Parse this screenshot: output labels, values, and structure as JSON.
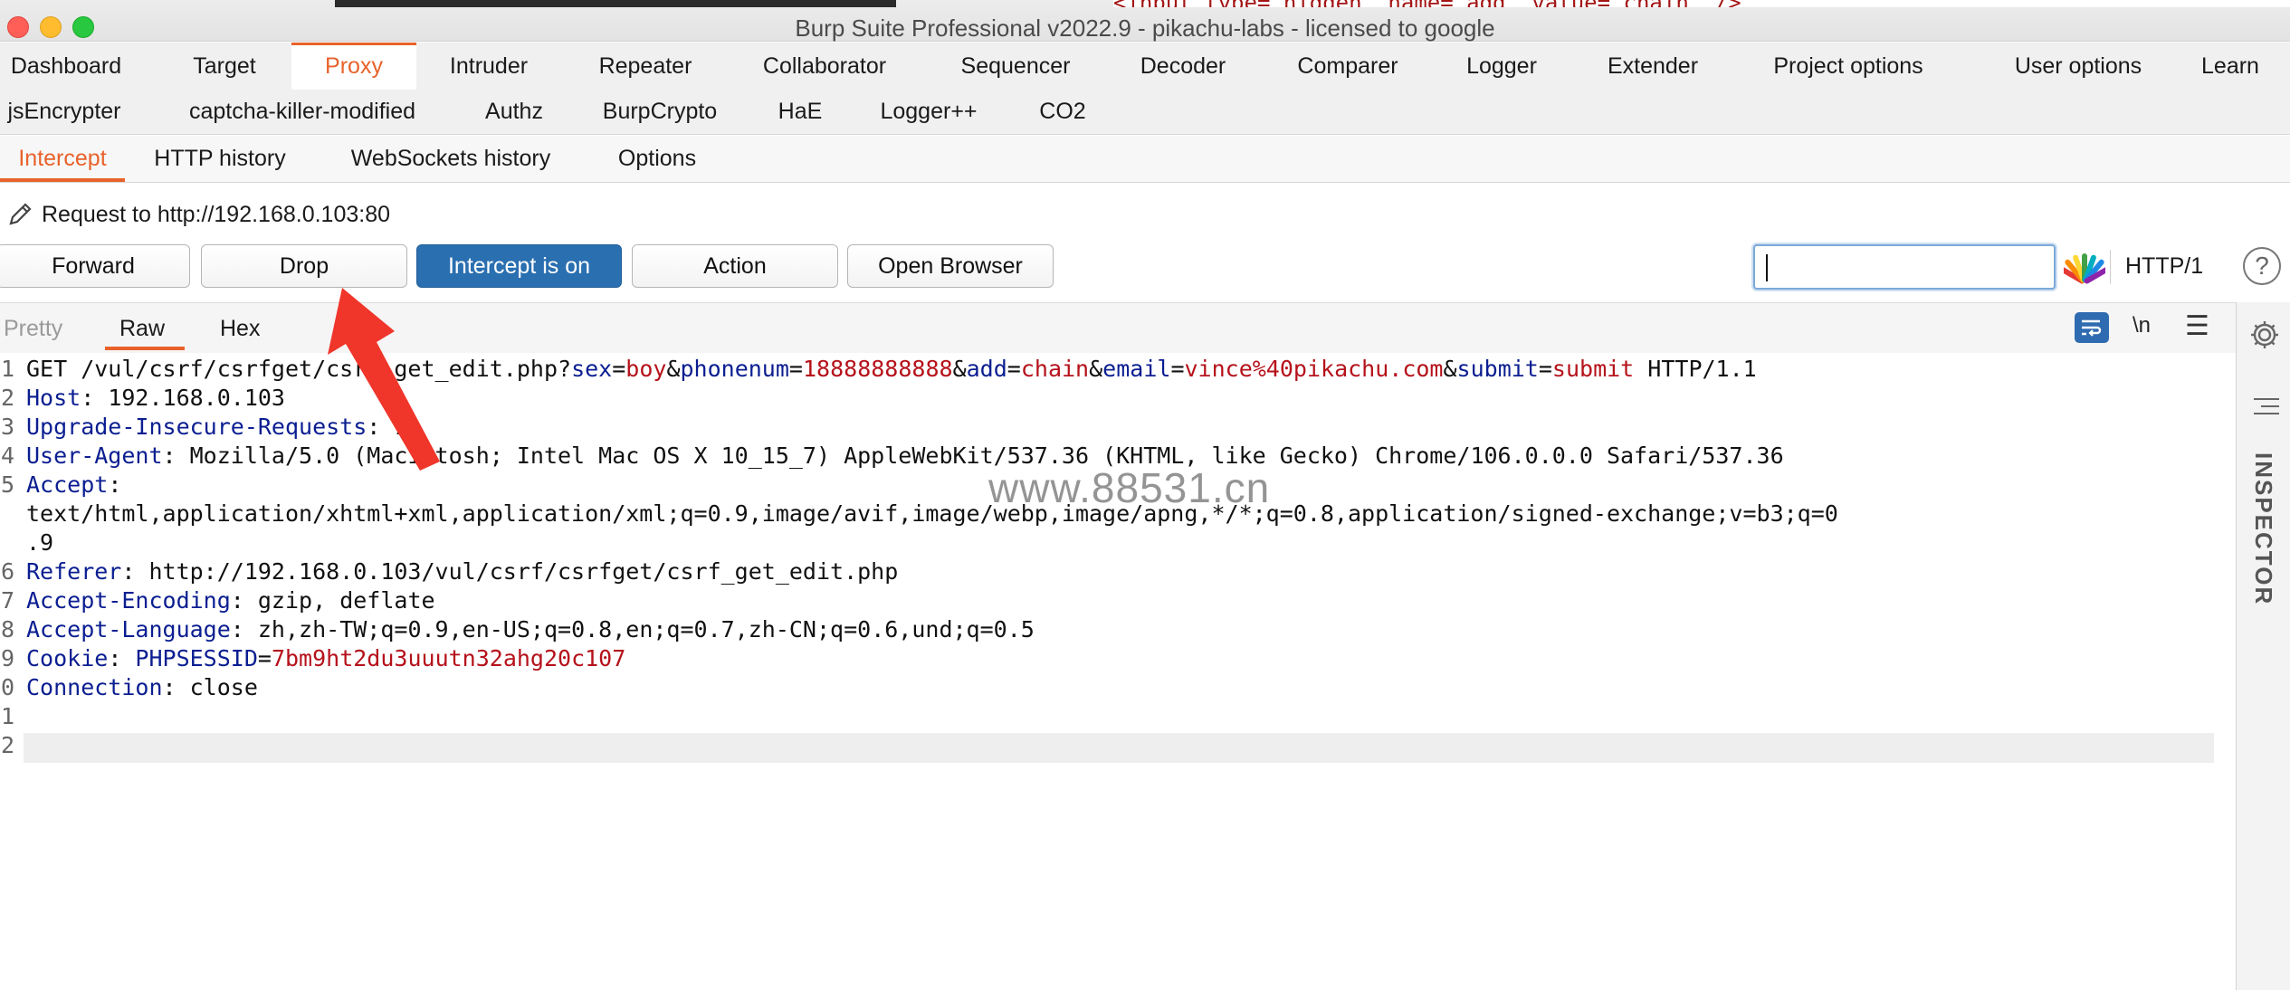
{
  "window": {
    "title": "Burp Suite Professional v2022.9 - pikachu-labs - licensed to google",
    "background_snippet": "<input type=\"hidden\" name=\"add\" value=\"chain\" />"
  },
  "main_tabs": [
    {
      "label": "Dashboard"
    },
    {
      "label": "Target"
    },
    {
      "label": "Proxy",
      "active": true
    },
    {
      "label": "Intruder"
    },
    {
      "label": "Repeater"
    },
    {
      "label": "Collaborator"
    },
    {
      "label": "Sequencer"
    },
    {
      "label": "Decoder"
    },
    {
      "label": "Comparer"
    },
    {
      "label": "Logger"
    },
    {
      "label": "Extender"
    },
    {
      "label": "Project options"
    },
    {
      "label": "User options"
    },
    {
      "label": "Learn"
    }
  ],
  "extension_tabs": [
    {
      "label": "jsEncrypter"
    },
    {
      "label": "captcha-killer-modified"
    },
    {
      "label": "Authz"
    },
    {
      "label": "BurpCrypto"
    },
    {
      "label": "HaE"
    },
    {
      "label": "Logger++"
    },
    {
      "label": "CO2"
    }
  ],
  "proxy_tabs": [
    {
      "label": "Intercept",
      "active": true
    },
    {
      "label": "HTTP history"
    },
    {
      "label": "WebSockets history"
    },
    {
      "label": "Options"
    }
  ],
  "request_info": "Request to http://192.168.0.103:80",
  "toolbar": {
    "forward": "Forward",
    "drop": "Drop",
    "intercept": "Intercept is on",
    "action": "Action",
    "open_browser": "Open Browser",
    "search_value": "",
    "http_version": "HTTP/1",
    "help": "?"
  },
  "editor": {
    "tabs": {
      "pretty": "Pretty",
      "raw": "Raw",
      "hex": "Hex"
    },
    "newline_toggle": "\\n",
    "lines": [
      {
        "n": "1",
        "parts": [
          {
            "t": "GET /vul/csrf/csrfget/csrf_get_edit.php?",
            "c": ""
          },
          {
            "t": "sex",
            "c": "pk"
          },
          {
            "t": "=",
            "c": ""
          },
          {
            "t": "boy",
            "c": "pv"
          },
          {
            "t": "&",
            "c": ""
          },
          {
            "t": "phonenum",
            "c": "pk"
          },
          {
            "t": "=",
            "c": ""
          },
          {
            "t": "18888888888",
            "c": "pv"
          },
          {
            "t": "&",
            "c": ""
          },
          {
            "t": "add",
            "c": "pk"
          },
          {
            "t": "=",
            "c": ""
          },
          {
            "t": "chain",
            "c": "pv"
          },
          {
            "t": "&",
            "c": ""
          },
          {
            "t": "email",
            "c": "pk"
          },
          {
            "t": "=",
            "c": ""
          },
          {
            "t": "vince%40pikachu.com",
            "c": "pv"
          },
          {
            "t": "&",
            "c": ""
          },
          {
            "t": "submit",
            "c": "pk"
          },
          {
            "t": "=",
            "c": ""
          },
          {
            "t": "submit",
            "c": "pv"
          },
          {
            "t": " HTTP/1.1",
            "c": ""
          }
        ]
      },
      {
        "n": "2",
        "parts": [
          {
            "t": "Host",
            "c": "hk"
          },
          {
            "t": ": 192.168.0.103",
            "c": ""
          }
        ]
      },
      {
        "n": "3",
        "parts": [
          {
            "t": "Upgrade-Insecure-Requests",
            "c": "hk"
          },
          {
            "t": ": 1",
            "c": ""
          }
        ]
      },
      {
        "n": "4",
        "parts": [
          {
            "t": "User-Agent",
            "c": "hk"
          },
          {
            "t": ": Mozilla/5.0 (Macintosh; Intel Mac OS X 10_15_7) AppleWebKit/537.36 (KHTML, like Gecko) Chrome/106.0.0.0 Safari/537.36",
            "c": ""
          }
        ]
      },
      {
        "n": "5",
        "parts": [
          {
            "t": "Accept",
            "c": "hk"
          },
          {
            "t": ":",
            "c": ""
          }
        ]
      },
      {
        "n": "",
        "parts": [
          {
            "t": "text/html,application/xhtml+xml,application/xml;q=0.9,image/avif,image/webp,image/apng,*/*;q=0.8,application/signed-exchange;v=b3;q=0",
            "c": ""
          }
        ]
      },
      {
        "n": "",
        "parts": [
          {
            "t": ".9",
            "c": ""
          }
        ]
      },
      {
        "n": "6",
        "parts": [
          {
            "t": "Referer",
            "c": "hk"
          },
          {
            "t": ": http://192.168.0.103/vul/csrf/csrfget/csrf_get_edit.php",
            "c": ""
          }
        ]
      },
      {
        "n": "7",
        "parts": [
          {
            "t": "Accept-Encoding",
            "c": "hk"
          },
          {
            "t": ": gzip, deflate",
            "c": ""
          }
        ]
      },
      {
        "n": "8",
        "parts": [
          {
            "t": "Accept-Language",
            "c": "hk"
          },
          {
            "t": ": zh,zh-TW;q=0.9,en-US;q=0.8,en;q=0.7,zh-CN;q=0.6,und;q=0.5",
            "c": ""
          }
        ]
      },
      {
        "n": "9",
        "parts": [
          {
            "t": "Cookie",
            "c": "hk"
          },
          {
            "t": ": ",
            "c": ""
          },
          {
            "t": "PHPSESSID",
            "c": "pk"
          },
          {
            "t": "=",
            "c": ""
          },
          {
            "t": "7bm9ht2du3uuutn32ahg20c107",
            "c": "pv"
          }
        ]
      },
      {
        "n": "0",
        "parts": [
          {
            "t": "Connection",
            "c": "hk"
          },
          {
            "t": ": close",
            "c": ""
          }
        ]
      },
      {
        "n": "1",
        "parts": []
      },
      {
        "n": "2",
        "parts": []
      }
    ]
  },
  "inspector": {
    "label": "INSPECTOR"
  },
  "watermark": "www.88531.cn",
  "colors": {
    "accent": "#e8622a",
    "intercept_on": "#2a6fb0",
    "header_key": "#0b1e91",
    "param_value": "#b5121b",
    "annotation_arrow": "#f0352a"
  }
}
